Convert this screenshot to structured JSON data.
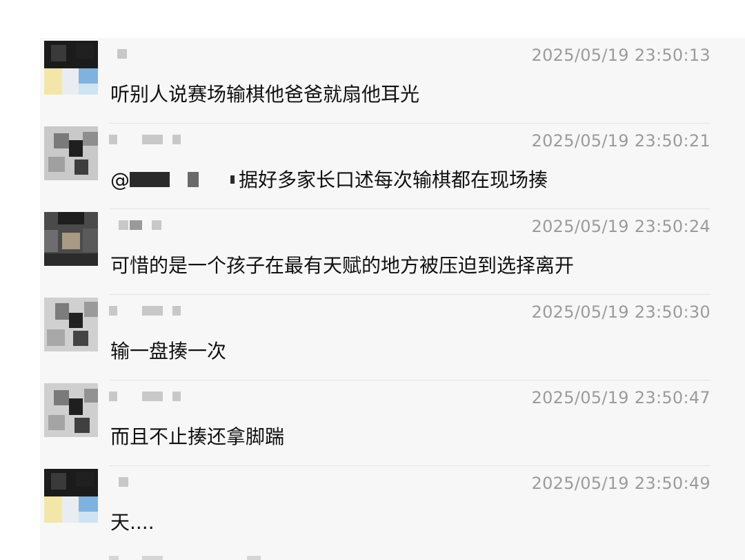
{
  "comments": [
    {
      "avatar": "pixelated-avatar-dark-hair",
      "name": "",
      "time": "2025/05/19 23:50:13",
      "text": "听别人说赛场输棋他爸爸就扇他耳光"
    },
    {
      "avatar": "pixelated-avatar-grey",
      "name": "",
      "time": "2025/05/19 23:50:21",
      "mention_prefix": "@",
      "text": "据好多家长口述每次输棋都在现场揍"
    },
    {
      "avatar": "pixelated-avatar-dark",
      "name": "",
      "time": "2025/05/19 23:50:24",
      "text": "可惜的是一个孩子在最有天赋的地方被压迫到选择离开"
    },
    {
      "avatar": "pixelated-avatar-grey",
      "name": "",
      "time": "2025/05/19 23:50:30",
      "text": "输一盘揍一次"
    },
    {
      "avatar": "pixelated-avatar-grey",
      "name": "",
      "time": "2025/05/19 23:50:47",
      "text": "而且不止揍还拿脚踹"
    },
    {
      "avatar": "pixelated-avatar-dark-hair",
      "name": "",
      "time": "2025/05/19 23:50:49",
      "text": "天...."
    }
  ]
}
